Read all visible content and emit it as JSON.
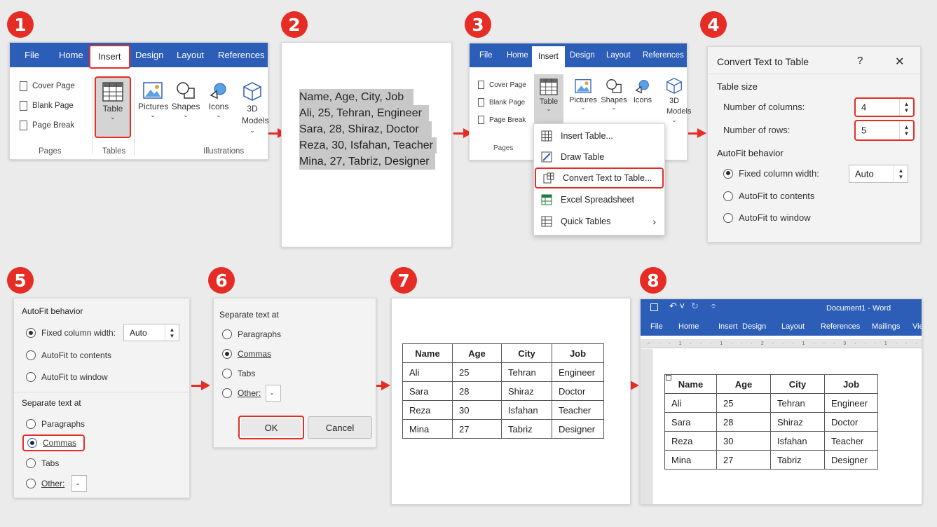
{
  "steps": [
    "1",
    "2",
    "3",
    "4",
    "5",
    "6",
    "7",
    "8"
  ],
  "ribbon1": {
    "tabs": [
      "File",
      "Home",
      "Insert",
      "Design",
      "Layout",
      "References"
    ],
    "pages_items": [
      "Cover Page",
      "Blank Page",
      "Page Break"
    ],
    "table_label": "Table",
    "illus": [
      "Pictures",
      "Shapes",
      "Icons",
      "3D Models"
    ],
    "groups": [
      "Pages",
      "Tables",
      "Illustrations"
    ]
  },
  "text_lines": [
    "Name, Age, City, Job",
    "Ali, 25, Tehran, Engineer",
    "Sara, 28, Shiraz, Doctor",
    "Reza, 30, Isfahan, Teacher",
    "Mina, 27, Tabriz, Designer"
  ],
  "ribbon3": {
    "tabs": [
      "File",
      "Home",
      "Insert",
      "Design",
      "Layout",
      "References"
    ],
    "pages_items": [
      "Cover Page",
      "Blank Page",
      "Page Break"
    ],
    "table_label": "Table",
    "illus": [
      "Pictures",
      "Shapes",
      "Icons",
      "3D Models"
    ],
    "group": "Pages",
    "menu": [
      "Insert Table...",
      "Draw Table",
      "Convert Text to Table...",
      "Excel Spreadsheet",
      "Quick Tables"
    ]
  },
  "dialog4": {
    "title": "Convert Text to Table",
    "help": "?",
    "close": "✕",
    "table_size": "Table size",
    "cols_label": "Number of columns:",
    "cols": "4",
    "rows_label": "Number of rows:",
    "rows": "5",
    "autofit": "AutoFit behavior",
    "fixed": "Fixed column width:",
    "fixed_val": "Auto",
    "contents": "AutoFit to contents",
    "window": "AutoFit to window"
  },
  "panel5": {
    "autofit": "AutoFit behavior",
    "fixed": "Fixed column width:",
    "fixed_val": "Auto",
    "contents": "AutoFit to contents",
    "window": "AutoFit to window",
    "separate": "Separate text at",
    "paragraphs": "Paragraphs",
    "commas": "Commas",
    "tabs": "Tabs",
    "other": "Other:",
    "other_val": "-"
  },
  "panel6": {
    "separate": "Separate text at",
    "paragraphs": "Paragraphs",
    "commas": "Commas",
    "tabs": "Tabs",
    "other": "Other:",
    "other_val": "-",
    "ok": "OK",
    "cancel": "Cancel"
  },
  "table_data": [
    [
      "Name",
      "Age",
      "City",
      "Job"
    ],
    [
      "Ali",
      "25",
      "Tehran",
      "Engineer"
    ],
    [
      "Sara",
      "28",
      "Shiraz",
      "Doctor"
    ],
    [
      "Reza",
      "30",
      "Isfahan",
      "Teacher"
    ],
    [
      "Mina",
      "27",
      "Tabriz",
      "Designer"
    ]
  ],
  "word": {
    "title": "Document1 - Word",
    "tabs": [
      "File",
      "Home",
      "Insert",
      "Design",
      "Layout",
      "References",
      "Mailings",
      "Vie"
    ]
  },
  "colors": {
    "accent": "#e62d25",
    "ribbon": "#2c5eb8"
  }
}
